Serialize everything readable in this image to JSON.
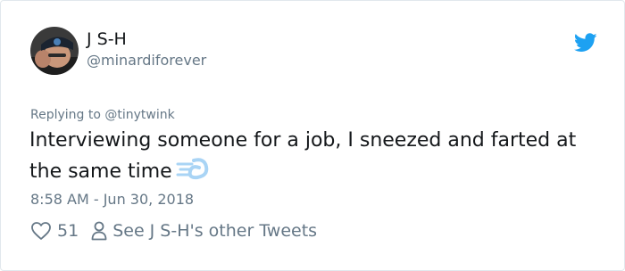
{
  "author": {
    "display_name": "J S-H",
    "handle": "@minardiforever"
  },
  "reply_context": {
    "prefix": "Replying to",
    "mention": "@tinytwink"
  },
  "tweet": {
    "text": "Interviewing someone for a job, I sneezed and farted at the same time",
    "emoji": "dash-emoji",
    "timestamp": "8:58 AM - Jun 30, 2018"
  },
  "actions": {
    "likes": "51",
    "other_tweets_label": "See J S-H's other Tweets"
  },
  "icons": {
    "brand": "twitter-bird-icon",
    "like": "heart-icon",
    "profile": "person-icon"
  },
  "colors": {
    "brand_blue": "#1da1f2",
    "text": "#14171a",
    "muted": "#657786",
    "border": "#e1e8ed"
  }
}
